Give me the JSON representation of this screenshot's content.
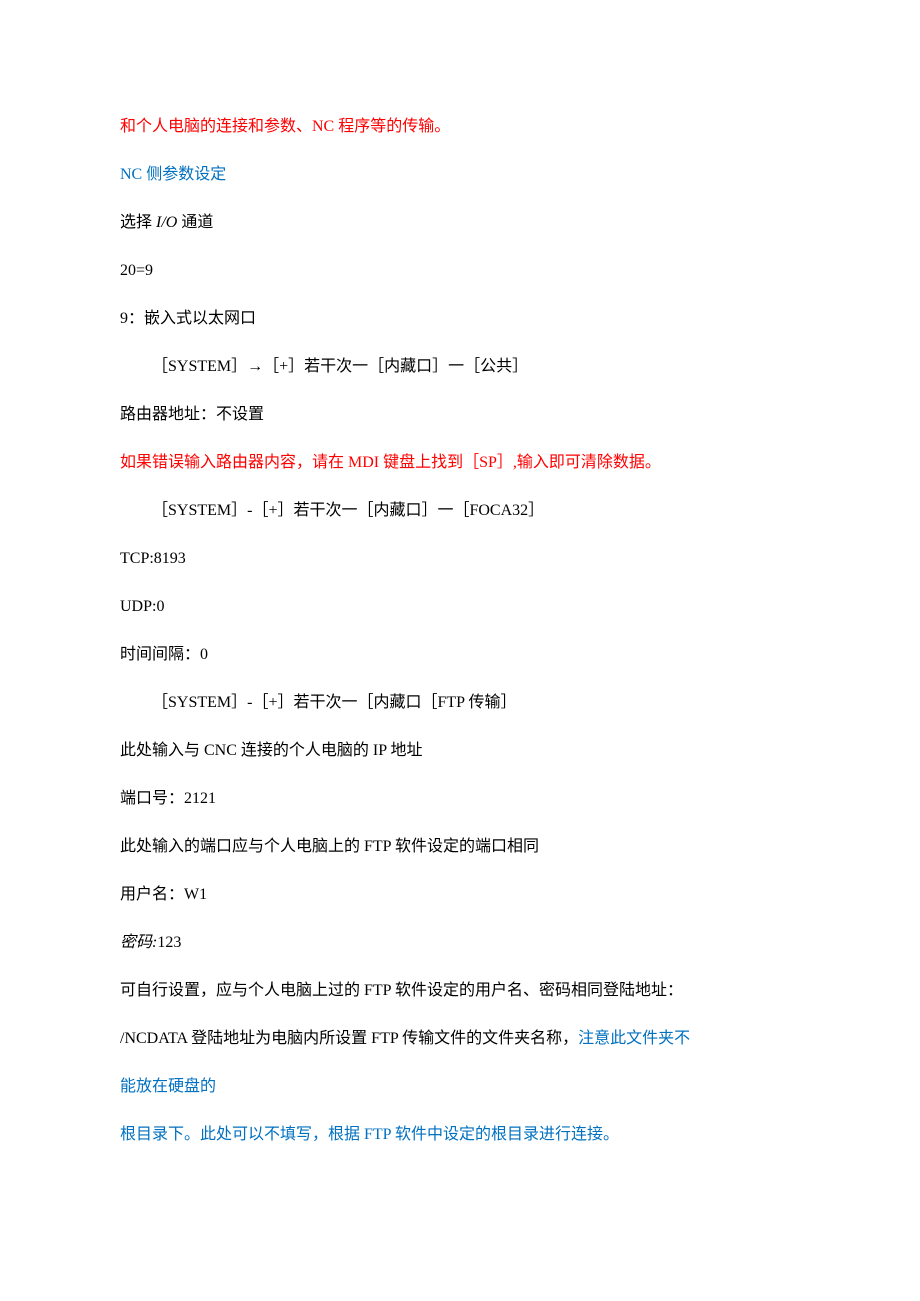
{
  "lines": {
    "l1": "和个人电脑的连接和参数、NC 程序等的传输。",
    "l2": "NC 侧参数设定",
    "l3a": "选择 ",
    "l3b": "I/O",
    "l3c": " 通道",
    "l4": "20=9",
    "l5": "9：嵌入式以太网口",
    "l6": "［SYSTEM］→［+］若干次一［内藏口］一［公共］",
    "l7": "路由器地址：不设置",
    "l8": "如果错误输入路由器内容，请在 MDI 键盘上找到［SP］,输入即可清除数据。",
    "l9": "［SYSTEM］-［+］若干次一［内藏口］一［FOCA32］",
    "l10": "TCP:8193",
    "l11": "UDP:0",
    "l12": "时间间隔：0",
    "l13": "［SYSTEM］-［+］若干次一［内藏口［FTP 传输］",
    "l14": "此处输入与 CNC 连接的个人电脑的 IP 地址",
    "l15": "端口号：2121",
    "l16": "此处输入的端口应与个人电脑上的 FTP 软件设定的端口相同",
    "l17": "用户名：W1",
    "l18a": "密码:",
    "l18b": "123",
    "l19": "可自行设置，应与个人电脑上过的 FTP 软件设定的用户名、密码相同登陆地址：",
    "l20a": "/NCDATA 登陆地址为电脑内所设置 FTP 传输文件的文件夹名称，",
    "l20b": "注意此文件夹不",
    "l21": "能放在硬盘的",
    "l22": "根目录下。此处可以不填写，根据 FTP 软件中设定的根目录进行连接。"
  }
}
